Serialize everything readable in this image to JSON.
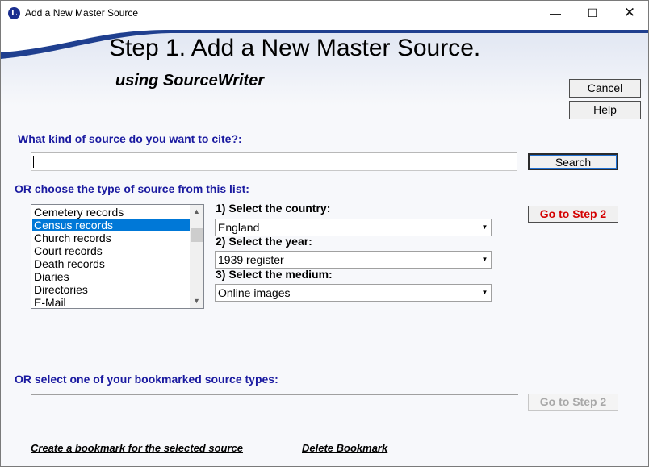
{
  "window": {
    "title": "Add a New Master Source",
    "app_icon_letter": "L",
    "controls": {
      "minimize": "—",
      "maximize": "☐",
      "close": "✕"
    }
  },
  "header": {
    "title": "Step 1.  Add a New Master Source.",
    "subtitle": "using SourceWriter",
    "cancel_label": "Cancel",
    "help_label": "Help"
  },
  "search_section": {
    "prompt": "What kind of source do you want to cite?:",
    "input_value": "",
    "search_label": "Search"
  },
  "list_section": {
    "prompt": "OR choose the type of source from this list:",
    "items": [
      {
        "label": "Cemetery records",
        "selected": false
      },
      {
        "label": "Census records",
        "selected": true
      },
      {
        "label": "Church records",
        "selected": false
      },
      {
        "label": "Court records",
        "selected": false
      },
      {
        "label": "Death records",
        "selected": false
      },
      {
        "label": "Diaries",
        "selected": false
      },
      {
        "label": "Directories",
        "selected": false
      },
      {
        "label": "E-Mail",
        "selected": false
      }
    ],
    "country_label": "1) Select the country:",
    "country_value": "England",
    "year_label": "2) Select the year:",
    "year_value": "1939 register",
    "medium_label": "3) Select the medium:",
    "medium_value": "Online images",
    "go_step2_label": "Go to Step 2"
  },
  "bookmark_section": {
    "prompt": "OR select one of your bookmarked source types:",
    "go_step2_label": "Go to Step 2",
    "create_link": "Create a bookmark for the selected source",
    "delete_link": "Delete Bookmark"
  },
  "colors": {
    "label_blue": "#1a1aa0",
    "step2_red": "#d40000",
    "selection": "#0078d7",
    "banner_blue": "#1f3f8f"
  }
}
